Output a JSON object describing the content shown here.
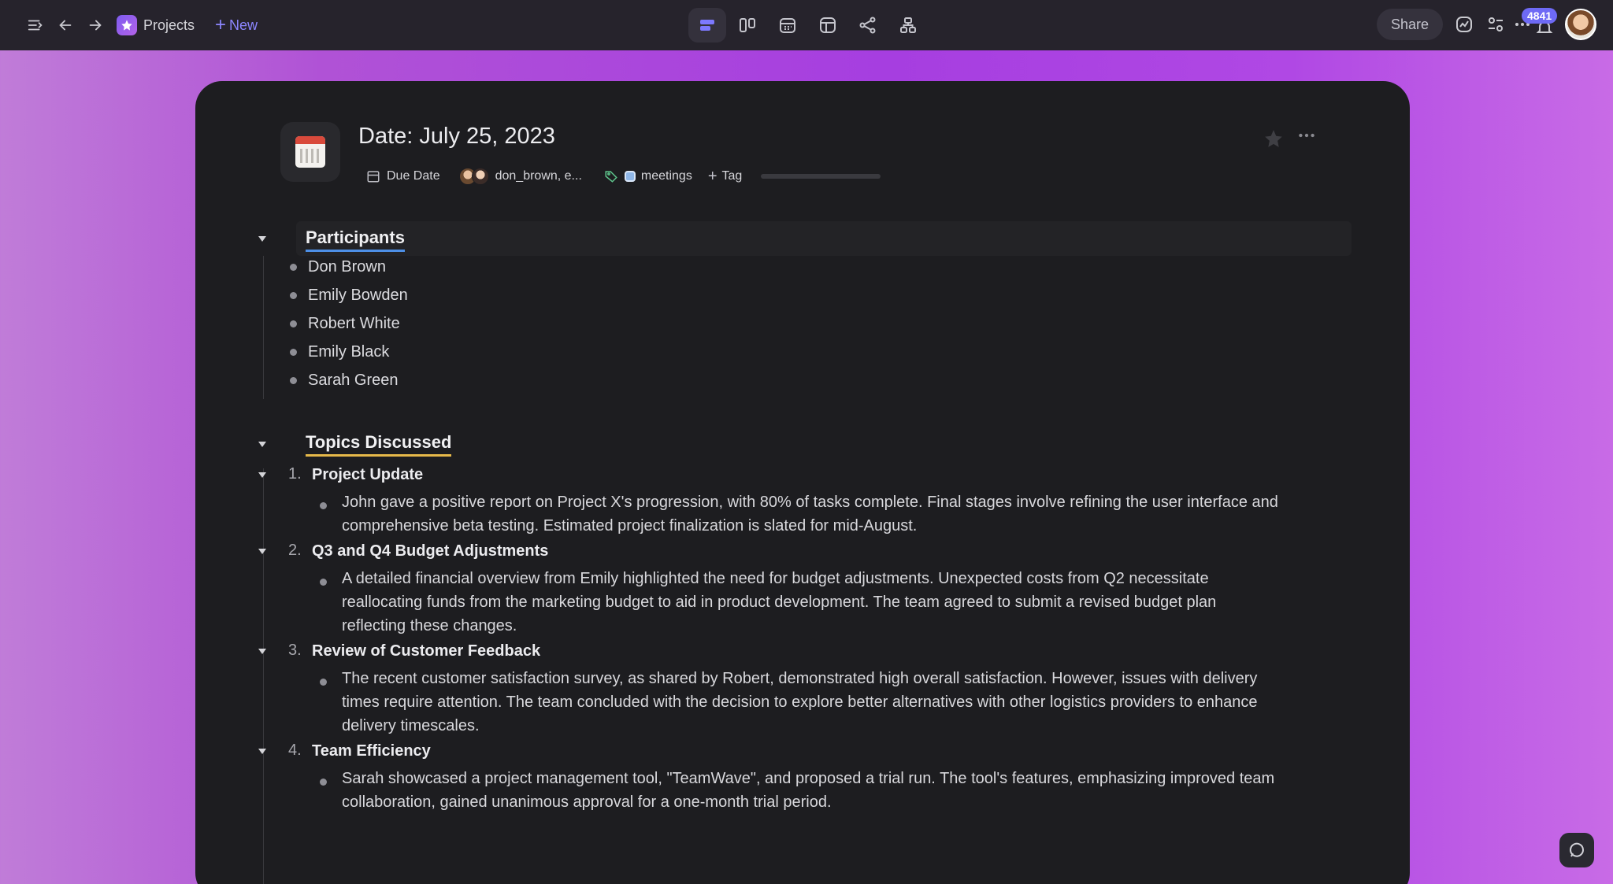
{
  "topbar": {
    "project_name": "Projects",
    "new_label": "New",
    "share_label": "Share",
    "notification_count": "4841",
    "views": [
      "list-view",
      "board-view",
      "calendar-view",
      "table-view",
      "graph-view",
      "hierarchy-view"
    ]
  },
  "doc": {
    "title": "Date: July 25, 2023",
    "props": {
      "due_date": "Due Date",
      "assignees": "don_brown, e...",
      "tag": "meetings",
      "add_tag": "Tag"
    }
  },
  "participants": {
    "heading": "Participants",
    "items": [
      "Don Brown",
      "Emily Bowden",
      "Robert White",
      "Emily Black",
      "Sarah Green"
    ]
  },
  "topics": {
    "heading": "Topics Discussed",
    "items": [
      {
        "num": "1.",
        "title": "Project Update",
        "text": "John gave a positive report on Project X's progression, with 80% of tasks complete. Final stages involve refining the user interface and comprehensive beta testing. Estimated project finalization is slated for mid-August."
      },
      {
        "num": "2.",
        "title": "Q3 and Q4 Budget Adjustments",
        "text": "A detailed financial overview from Emily highlighted the need for budget adjustments. Unexpected costs from Q2 necessitate reallocating funds from the marketing budget to aid in product development. The team agreed to submit a revised budget plan reflecting these changes."
      },
      {
        "num": "3.",
        "title": "Review of Customer Feedback",
        "text": "The recent customer satisfaction survey, as shared by Robert, demonstrated high overall satisfaction. However, issues with delivery times require attention. The team concluded with the decision to explore better alternatives with other logistics providers to enhance delivery timescales."
      },
      {
        "num": "4.",
        "title": "Team Efficiency",
        "text": "Sarah showcased a project management tool, \"TeamWave\", and proposed a trial run. The tool's features, emphasizing improved team collaboration, gained unanimous approval for a one-month trial period."
      }
    ]
  }
}
